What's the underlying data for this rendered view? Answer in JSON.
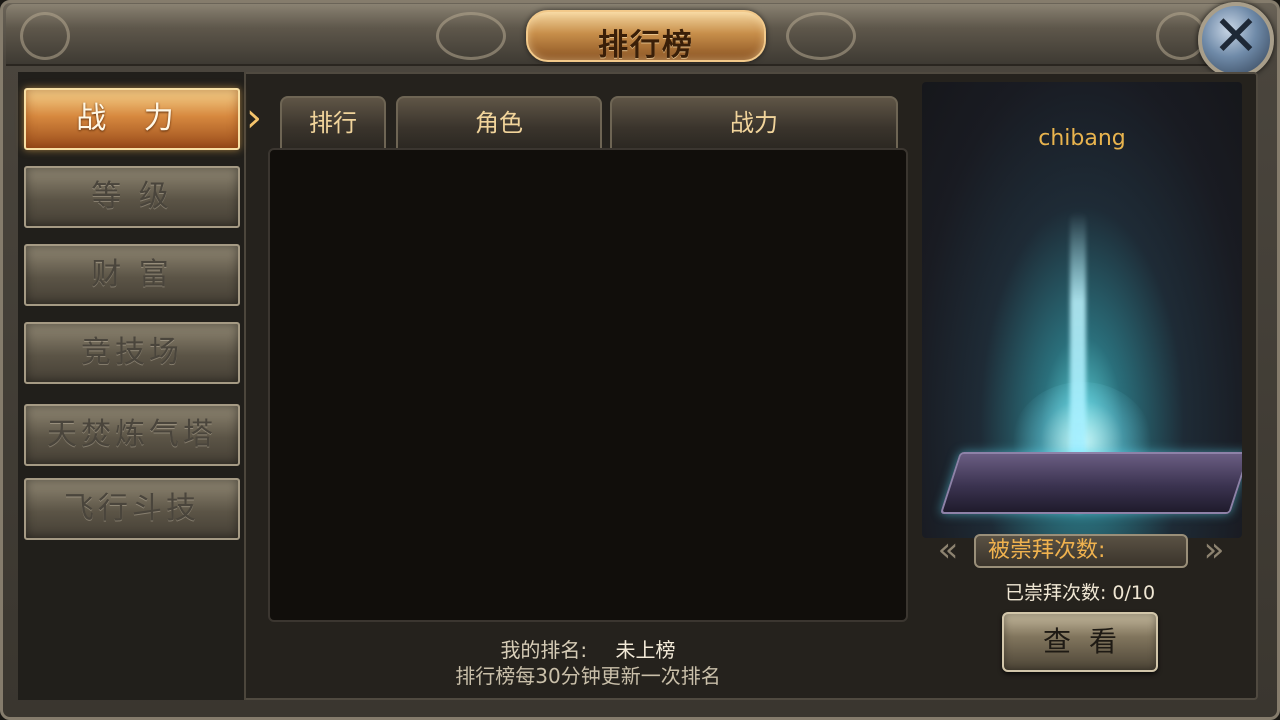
{
  "window": {
    "title": "排行榜",
    "close_icon": "close-icon"
  },
  "categories": [
    {
      "label": "战 力",
      "active": true
    },
    {
      "label": "等 级",
      "active": false
    },
    {
      "label": "财 富",
      "active": false
    },
    {
      "label": "竞技场",
      "active": false
    },
    {
      "label": "天焚炼气塔",
      "active": false
    },
    {
      "label": "飞行斗技",
      "active": false
    }
  ],
  "table": {
    "columns": [
      "排行",
      "角色",
      "战力"
    ],
    "rows": []
  },
  "footer": {
    "my_rank_label": "我的排名:",
    "my_rank_value": "未上榜",
    "update_note": "排行榜每30分钟更新一次排名"
  },
  "preview": {
    "character_name": "chibang",
    "worship_banner": "被崇拜次数:",
    "worship_count": "已崇拜次数: 0/10",
    "view_button": "查看"
  },
  "colors": {
    "active_tab": "#d7893f",
    "gold_text": "#e9b44e",
    "header_text": "#f1d49b"
  }
}
